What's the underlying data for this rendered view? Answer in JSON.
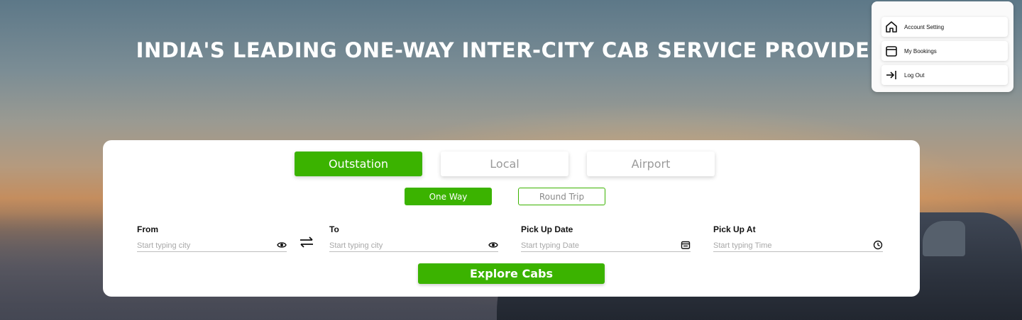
{
  "hero": {
    "headline": "INDIA'S LEADING ONE-WAY INTER-CITY CAB SERVICE PROVIDER"
  },
  "account_menu": {
    "items": [
      {
        "label": "Account Setting",
        "icon": "home-icon"
      },
      {
        "label": "My Bookings",
        "icon": "calendar-icon"
      },
      {
        "label": "Log Out",
        "icon": "logout-icon"
      }
    ]
  },
  "booking": {
    "tabs": [
      {
        "label": "Outstation",
        "active": true
      },
      {
        "label": "Local",
        "active": false
      },
      {
        "label": "Airport",
        "active": false
      }
    ],
    "trip_types": [
      {
        "label": "One Way",
        "active": true
      },
      {
        "label": "Round Trip",
        "active": false
      }
    ],
    "fields": [
      {
        "label": "From",
        "placeholder": "Start typing city",
        "icon": "location-icon"
      },
      {
        "label": "To",
        "placeholder": "Start typing city",
        "icon": "location-icon"
      },
      {
        "label": "Pick Up Date",
        "placeholder": "Start typing Date",
        "icon": "calendar-icon"
      },
      {
        "label": "Pick Up At",
        "placeholder": "Start typing Time",
        "icon": "clock-icon"
      }
    ],
    "swap_icon": "swap-icon",
    "submit_label": "Explore Cabs"
  },
  "colors": {
    "accent": "#3bb300",
    "panel": "#ffffff",
    "placeholder": "#a8a8a8"
  }
}
